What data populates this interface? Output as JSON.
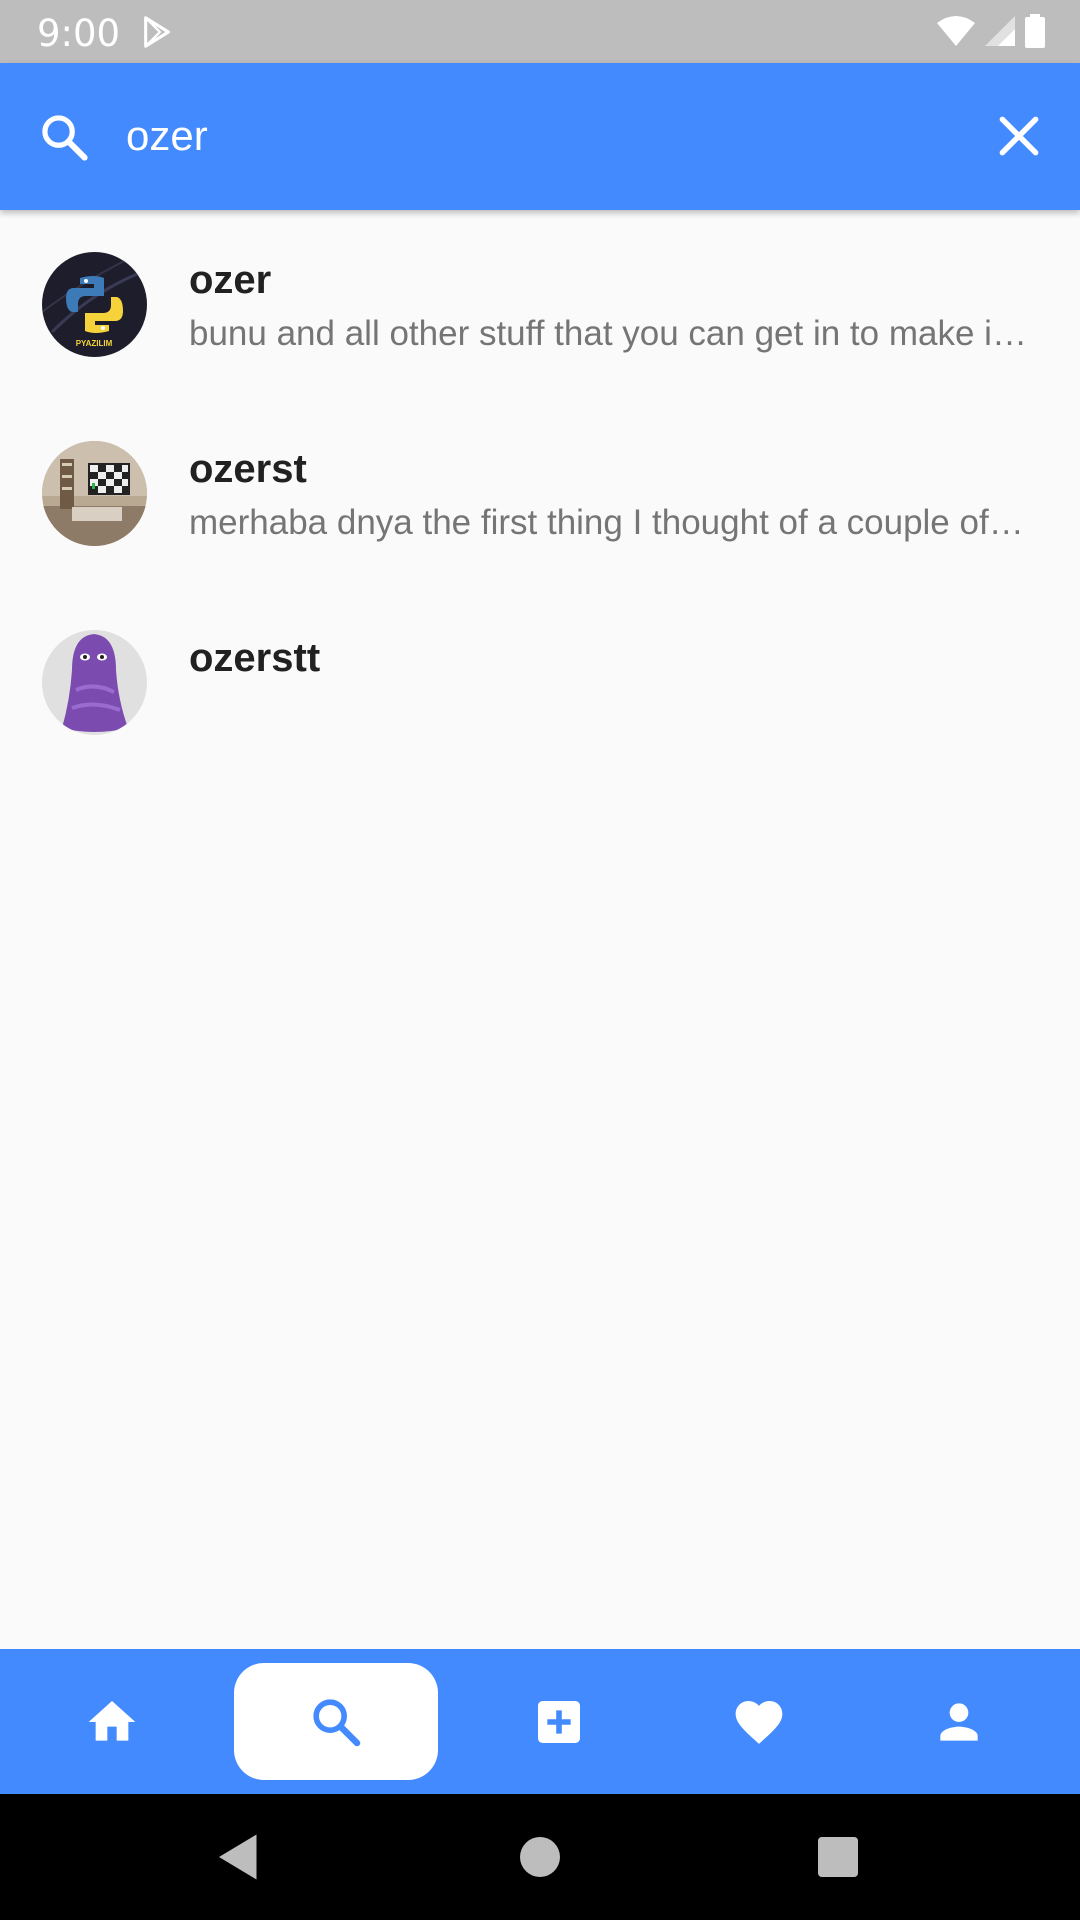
{
  "status_bar": {
    "time": "9:00"
  },
  "search": {
    "query": "ozer"
  },
  "results": [
    {
      "name": "ozer",
      "bio": "bunu and all other stuff that you can get in to make it work for you and the rest",
      "avatar_text": "PYAZILIM"
    },
    {
      "name": "ozerst",
      "bio": "merhaba dnya the first thing I thought of a couple of weeks ago was how much",
      "avatar_text": ""
    },
    {
      "name": "ozerstt",
      "bio": "",
      "avatar_text": ""
    }
  ],
  "bottom_nav": {
    "items": [
      "home-icon",
      "search-icon",
      "add-box-icon",
      "heart-icon",
      "person-icon"
    ],
    "active": "search-icon"
  },
  "colors": {
    "primary": "#448AFF",
    "status_bar": "#BDBDBD",
    "background": "#FAFAFA",
    "name_text": "#212121",
    "bio_text": "#757575"
  }
}
